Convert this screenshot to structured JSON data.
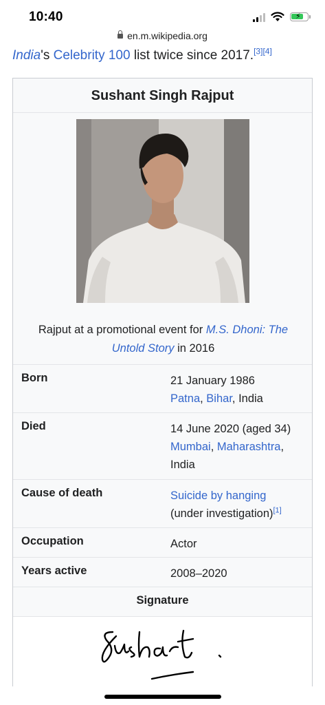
{
  "status": {
    "time": "10:40",
    "url": "en.m.wikipedia.org"
  },
  "intro": {
    "link1": "India",
    "text1": "'s ",
    "link2": "Celebrity 100",
    "text2": " list twice since 2017.",
    "ref1": "[3]",
    "ref2": "[4]"
  },
  "infobox": {
    "title": "Sushant Singh Rajput",
    "caption": {
      "prefix": "Rajput at a promotional event for ",
      "film_link": "M.S. Dhoni: The Untold Story",
      "suffix": " in 2016"
    },
    "born": {
      "label": "Born",
      "date": "21 January 1986",
      "city": "Patna",
      "sep": ", ",
      "state": "Bihar",
      "country": ", India"
    },
    "died": {
      "label": "Died",
      "date": "14 June 2020 (aged 34)",
      "city": "Mumbai",
      "sep": ", ",
      "state": "Maharashtra",
      "country": ", India"
    },
    "cause": {
      "label": "Cause of death",
      "link": "Suicide by hanging",
      "note": "(under investigation)",
      "ref": "[1]"
    },
    "occupation": {
      "label": "Occupation",
      "value": "Actor"
    },
    "years_active": {
      "label": "Years active",
      "value": "2008–2020"
    },
    "signature": {
      "label": "Signature",
      "text": "Sushant"
    }
  }
}
